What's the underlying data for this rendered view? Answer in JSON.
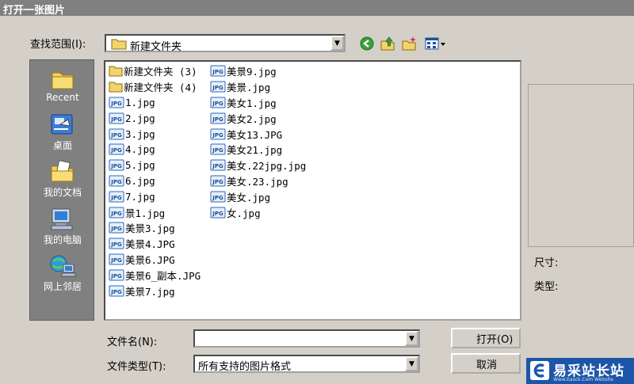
{
  "window": {
    "title": "打开一张图片"
  },
  "lookin": {
    "label": "查找范围(I):",
    "value": "新建文件夹"
  },
  "toolbar": {
    "icons": [
      "back-icon",
      "up-folder-icon",
      "new-folder-icon",
      "view-menu-icon"
    ]
  },
  "places": [
    {
      "label": "Recent",
      "icon": "recent-folder-icon"
    },
    {
      "label": "桌面",
      "icon": "desktop-icon"
    },
    {
      "label": "我的文档",
      "icon": "documents-folder-icon"
    },
    {
      "label": "我的电脑",
      "icon": "computer-icon"
    },
    {
      "label": "网上邻居",
      "icon": "network-icon"
    }
  ],
  "files": {
    "col1": [
      {
        "name": "新建文件夹 (3)",
        "type": "folder"
      },
      {
        "name": "新建文件夹 (4)",
        "type": "folder"
      },
      {
        "name": "1.jpg",
        "type": "jpg"
      },
      {
        "name": "2.jpg",
        "type": "jpg"
      },
      {
        "name": "3.jpg",
        "type": "jpg"
      },
      {
        "name": "4.jpg",
        "type": "jpg"
      },
      {
        "name": "5.jpg",
        "type": "jpg"
      },
      {
        "name": "6.jpg",
        "type": "jpg"
      },
      {
        "name": "7.jpg",
        "type": "jpg"
      },
      {
        "name": "景1.jpg",
        "type": "jpg"
      },
      {
        "name": "美景3.jpg",
        "type": "jpg"
      },
      {
        "name": "美景4.JPG",
        "type": "jpg"
      },
      {
        "name": "美景6.JPG",
        "type": "jpg"
      },
      {
        "name": "美景6_副本.JPG",
        "type": "jpg"
      },
      {
        "name": "美景7.jpg",
        "type": "jpg"
      }
    ],
    "col2": [
      {
        "name": "美景9.jpg",
        "type": "jpg"
      },
      {
        "name": "美景.jpg",
        "type": "jpg"
      },
      {
        "name": "美女1.jpg",
        "type": "jpg"
      },
      {
        "name": "美女2.jpg",
        "type": "jpg"
      },
      {
        "name": "美女13.JPG",
        "type": "jpg"
      },
      {
        "name": "美女21.jpg",
        "type": "jpg"
      },
      {
        "name": "美女.22jpg.jpg",
        "type": "jpg"
      },
      {
        "name": "美女.23.jpg",
        "type": "jpg"
      },
      {
        "name": "美女.jpg",
        "type": "jpg"
      },
      {
        "name": "女.jpg",
        "type": "jpg"
      }
    ]
  },
  "file_icon_label": "JPG",
  "preview": {
    "size_label": "尺寸:",
    "type_label": "类型:"
  },
  "filename": {
    "label": "文件名(N):",
    "value": ""
  },
  "filetype": {
    "label": "文件类型(T):",
    "value": "所有支持的图片格式"
  },
  "buttons": {
    "open": "打开(O)",
    "cancel": "取消"
  },
  "watermark": {
    "text": "易采站长站",
    "sub": "Www.Easck.Com Website"
  },
  "colors": {
    "dialog_bg": "#d4d0c8",
    "places_bg": "#808080",
    "titlebar": "#808080",
    "badge": "#1d56a8"
  }
}
